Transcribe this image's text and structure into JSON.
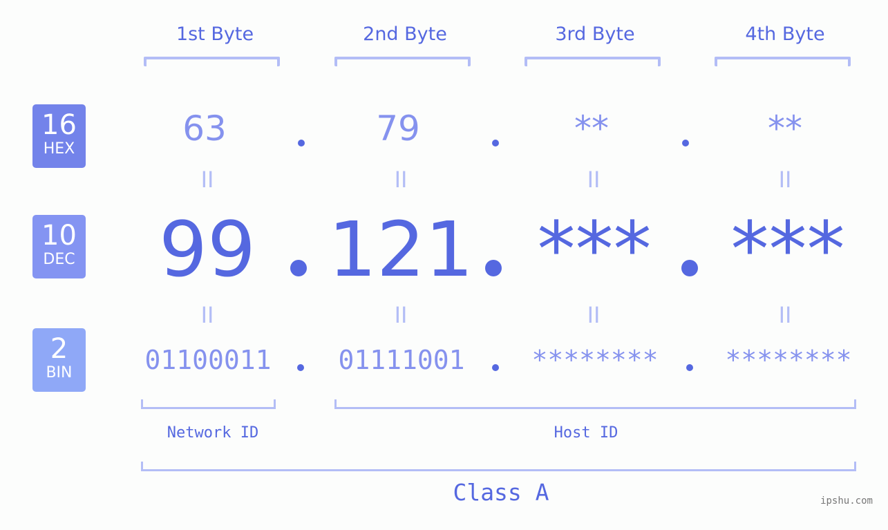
{
  "badges": [
    {
      "number": "16",
      "label": "HEX"
    },
    {
      "number": "10",
      "label": "DEC"
    },
    {
      "number": "2",
      "label": "BIN"
    }
  ],
  "byte_headers": [
    "1st Byte",
    "2nd Byte",
    "3rd Byte",
    "4th Byte"
  ],
  "hex_values": [
    "63",
    "79",
    "**",
    "**"
  ],
  "equals_symbol": "II",
  "dec_values": [
    "99",
    "121",
    "***",
    "***"
  ],
  "bin_values": [
    "01100011",
    "01111001",
    "********",
    "********"
  ],
  "network_id_label": "Network ID",
  "host_id_label": "Host ID",
  "class_label": "Class A",
  "watermark": "ipshu.com",
  "colors": {
    "accent": "#5568e0",
    "light_accent": "#8592ee",
    "bracket": "#b3bdf6",
    "hex_badge": "#7383ea",
    "dec_badge": "#8494f2",
    "bin_badge": "#8fa8f7"
  }
}
